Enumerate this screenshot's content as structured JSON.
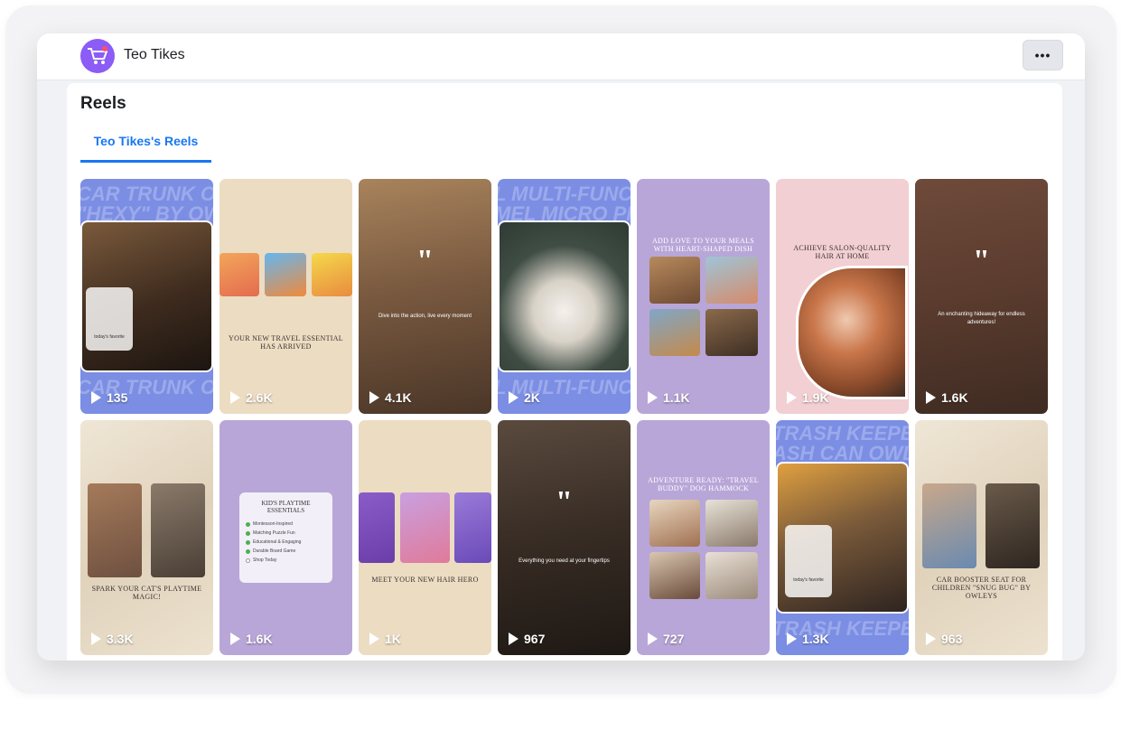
{
  "page": {
    "name": "Teo Tikes",
    "more_label": "•••",
    "section_title": "Reels",
    "tab_label": "Teo Tikes's Reels"
  },
  "colors": {
    "accent": "#1877f2",
    "avatar": "#8b5cf6",
    "beige": "#ecdcc2",
    "blue": "#7b8ee4",
    "lavender": "#b8a6d8",
    "pink": "#f2cfd2"
  },
  "reels": [
    {
      "views": "135",
      "theme": "blue-band",
      "card_text": "today's favorite"
    },
    {
      "views": "2.6K",
      "theme": "beige",
      "caption": "YOUR NEW TRAVEL ESSENTIAL HAS ARRIVED"
    },
    {
      "views": "4.1K",
      "theme": "photo-dark",
      "text": "Dive into the action, live every moment"
    },
    {
      "views": "2K",
      "theme": "blue-band"
    },
    {
      "views": "1.1K",
      "theme": "lavender",
      "caption": "ADD LOVE TO YOUR MEALS WITH HEART-SHAPED DISH"
    },
    {
      "views": "1.9K",
      "theme": "pink",
      "caption": "ACHIEVE SALON-QUALITY HAIR AT HOME"
    },
    {
      "views": "1.6K",
      "theme": "photo-brown",
      "text": "An enchanting hideaway for endless adventures!"
    },
    {
      "views": "3.3K",
      "theme": "marble",
      "caption": "SPARK YOUR CAT'S PLAYTIME MAGIC!"
    },
    {
      "views": "1.6K",
      "theme": "lavender-list",
      "caption": "KID'S PLAYTIME ESSENTIALS",
      "items": [
        "Montessori-Inspired",
        "Matching Puzzle Fun",
        "Educational & Engaging",
        "Durable Board Game",
        "Shop Today"
      ]
    },
    {
      "views": "1K",
      "theme": "beige",
      "caption": "MEET YOUR NEW HAIR HERO"
    },
    {
      "views": "967",
      "theme": "photo-car",
      "text": "Everything you need at your fingertips"
    },
    {
      "views": "727",
      "theme": "lavender",
      "caption": "ADVENTURE READY: \"TRAVEL BUDDY\" DOG HAMMOCK"
    },
    {
      "views": "1.3K",
      "theme": "blue-band",
      "card_text": "today's favorite"
    },
    {
      "views": "963",
      "theme": "marble",
      "caption": "CAR BOOSTER SEAT FOR CHILDREN \"SNUG BUG\" BY OWLEYS"
    }
  ]
}
